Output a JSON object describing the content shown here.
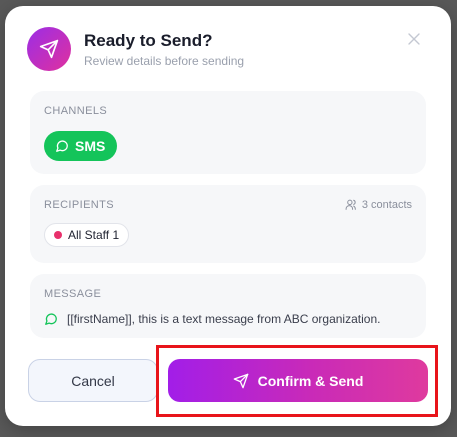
{
  "dialog": {
    "title": "Ready to Send?",
    "subtitle": "Review details before sending",
    "close_icon": "close-icon",
    "header_icon": "send-icon",
    "accent_gradient": [
      "#9b2ee6",
      "#e0309e"
    ]
  },
  "channels": {
    "label": "CHANNELS",
    "items": [
      {
        "label": "SMS",
        "icon": "chat-bubble-icon",
        "color": "#14c45a"
      }
    ]
  },
  "recipients": {
    "label": "RECIPIENTS",
    "count_text": "3 contacts",
    "count_icon": "users-icon",
    "items": [
      {
        "label": "All Staff 1",
        "dot_color": "#e8306c"
      }
    ]
  },
  "message": {
    "label": "MESSAGE",
    "icon": "chat-bubble-icon",
    "text": "[[firstName]], this is a text message from ABC organization."
  },
  "actions": {
    "cancel_label": "Cancel",
    "confirm_label": "Confirm & Send",
    "confirm_icon": "send-icon",
    "highlight_color": "#e8141a"
  }
}
